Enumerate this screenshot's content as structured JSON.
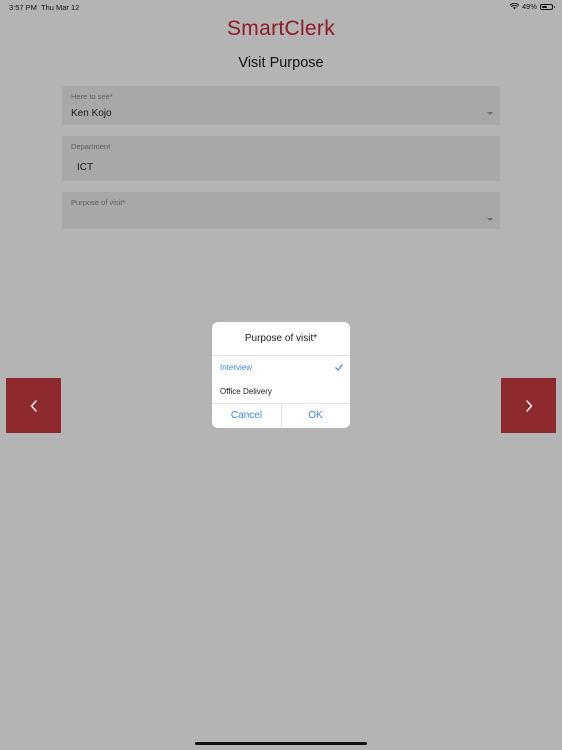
{
  "status_bar": {
    "time": "3:57 PM",
    "date": "Thu Mar 12",
    "battery": "49%",
    "battery_level": 0.49
  },
  "app": {
    "brand": "SmartClerk",
    "page_title": "Visit Purpose"
  },
  "form": {
    "here_to_see": {
      "label": "Here to see*",
      "value": "Ken Kojo"
    },
    "department": {
      "label": "Department",
      "value": "ICT"
    },
    "purpose": {
      "label": "Purpose of visit*",
      "value": ""
    }
  },
  "dialog": {
    "title": "Purpose of visit*",
    "options": [
      {
        "label": "Interview",
        "selected": true
      },
      {
        "label": "Office Delivery",
        "selected": false
      }
    ],
    "cancel_label": "Cancel",
    "ok_label": "OK"
  },
  "nav": {
    "prev_icon": "chevron-left-icon",
    "next_icon": "chevron-right-icon"
  },
  "colors": {
    "brand": "#8e1a24",
    "nav_button": "#8e2a2e",
    "accent": "#3f86e0",
    "backdrop": "#b4b4b4"
  }
}
